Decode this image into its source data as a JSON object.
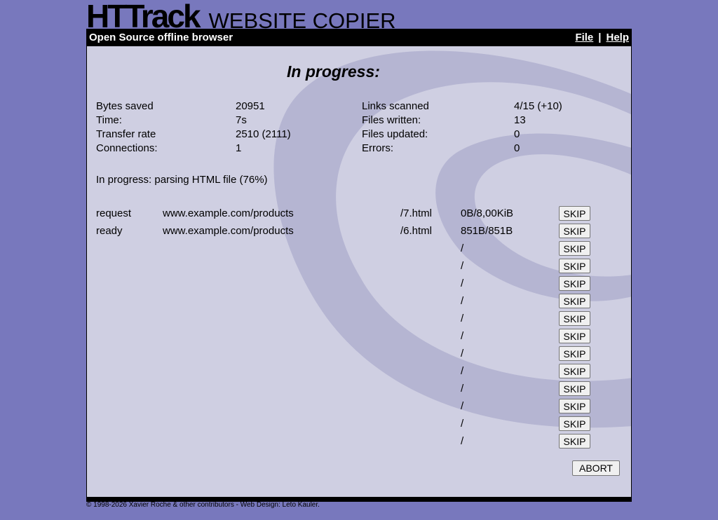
{
  "logo": {
    "main": "HTTrack",
    "sub": "WEBSITE COPIER"
  },
  "topbar": {
    "tagline": "Open Source offline browser",
    "file": "File",
    "separator": "|",
    "help": "Help"
  },
  "title": "In progress:",
  "stats_left": [
    {
      "label": "Bytes saved",
      "value": "20951"
    },
    {
      "label": "Time:",
      "value": "7s"
    },
    {
      "label": "Transfer rate",
      "value": "2510 (2111)"
    },
    {
      "label": "Connections:",
      "value": "1"
    }
  ],
  "stats_right": [
    {
      "label": "Links scanned",
      "value": "4/15 (+10)"
    },
    {
      "label": "Files written:",
      "value": "13"
    },
    {
      "label": "Files updated:",
      "value": "0"
    },
    {
      "label": "Errors:",
      "value": "0"
    }
  ],
  "status": "In progress: parsing HTML file (76%)",
  "transfers": [
    {
      "state": "request",
      "host": "www.example.com/products",
      "file": "/7.html",
      "size": "0B/8,00KiB",
      "button": "SKIP"
    },
    {
      "state": "ready",
      "host": "www.example.com/products",
      "file": "/6.html",
      "size": "851B/851B",
      "button": "SKIP"
    },
    {
      "state": "",
      "host": "",
      "file": "",
      "size": "/",
      "button": "SKIP"
    },
    {
      "state": "",
      "host": "",
      "file": "",
      "size": "/",
      "button": "SKIP"
    },
    {
      "state": "",
      "host": "",
      "file": "",
      "size": "/",
      "button": "SKIP"
    },
    {
      "state": "",
      "host": "",
      "file": "",
      "size": "/",
      "button": "SKIP"
    },
    {
      "state": "",
      "host": "",
      "file": "",
      "size": "/",
      "button": "SKIP"
    },
    {
      "state": "",
      "host": "",
      "file": "",
      "size": "/",
      "button": "SKIP"
    },
    {
      "state": "",
      "host": "",
      "file": "",
      "size": "/",
      "button": "SKIP"
    },
    {
      "state": "",
      "host": "",
      "file": "",
      "size": "/",
      "button": "SKIP"
    },
    {
      "state": "",
      "host": "",
      "file": "",
      "size": "/",
      "button": "SKIP"
    },
    {
      "state": "",
      "host": "",
      "file": "",
      "size": "/",
      "button": "SKIP"
    },
    {
      "state": "",
      "host": "",
      "file": "",
      "size": "/",
      "button": "SKIP"
    },
    {
      "state": "",
      "host": "",
      "file": "",
      "size": "/",
      "button": "SKIP"
    }
  ],
  "abort_label": "ABORT",
  "footer": "© 1998-2026 Xavier Roche & other contributors - Web Design: Leto Kauler.",
  "colors": {
    "background": "#7878bd",
    "panel": "#cfcfe2",
    "swirl": "#b5b5d2",
    "bar": "#000000"
  }
}
